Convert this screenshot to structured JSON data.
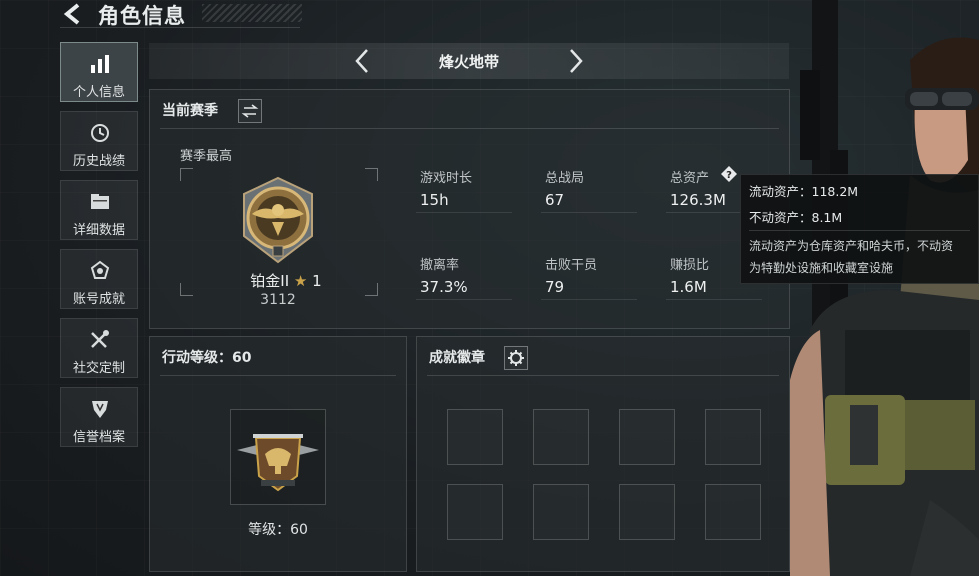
{
  "header": {
    "title": "角色信息"
  },
  "sidebar": {
    "items": [
      {
        "label": "个人信息",
        "icon": "bar-chart-icon",
        "active": true
      },
      {
        "label": "历史战绩",
        "icon": "history-icon"
      },
      {
        "label": "详细数据",
        "icon": "folder-icon"
      },
      {
        "label": "账号成就",
        "icon": "achievement-icon"
      },
      {
        "label": "社交定制",
        "icon": "tools-icon"
      },
      {
        "label": "信誉档案",
        "icon": "shield-icon"
      }
    ]
  },
  "mode": {
    "title": "烽火地带"
  },
  "season": {
    "title": "当前赛季",
    "best_label": "赛季最高",
    "rank_name": "铂金II",
    "rank_stars": "1",
    "rank_score": "3112",
    "stats": [
      {
        "label": "游戏时长",
        "value": "15h"
      },
      {
        "label": "总战局",
        "value": "67"
      },
      {
        "label": "总资产",
        "value": "126.3M"
      },
      {
        "label": "撤离率",
        "value": "37.3%"
      },
      {
        "label": "击败干员",
        "value": "79"
      },
      {
        "label": "赚损比",
        "value": "1.6M"
      }
    ]
  },
  "tooltip": {
    "liquid": "流动资产：118.2M",
    "fixed": "不动资产：8.1M",
    "desc1": "流动资产为仓库资产和哈夫币，不动资",
    "desc2": "为特勤处设施和收藏室设施"
  },
  "action": {
    "title": "行动等级：60",
    "level_text": "等级：60"
  },
  "badges": {
    "title": "成就徽章"
  },
  "colors": {
    "accent_gold": "#c9a24a",
    "panel_border": "#4a5255",
    "active_nav": "#3d4447"
  }
}
